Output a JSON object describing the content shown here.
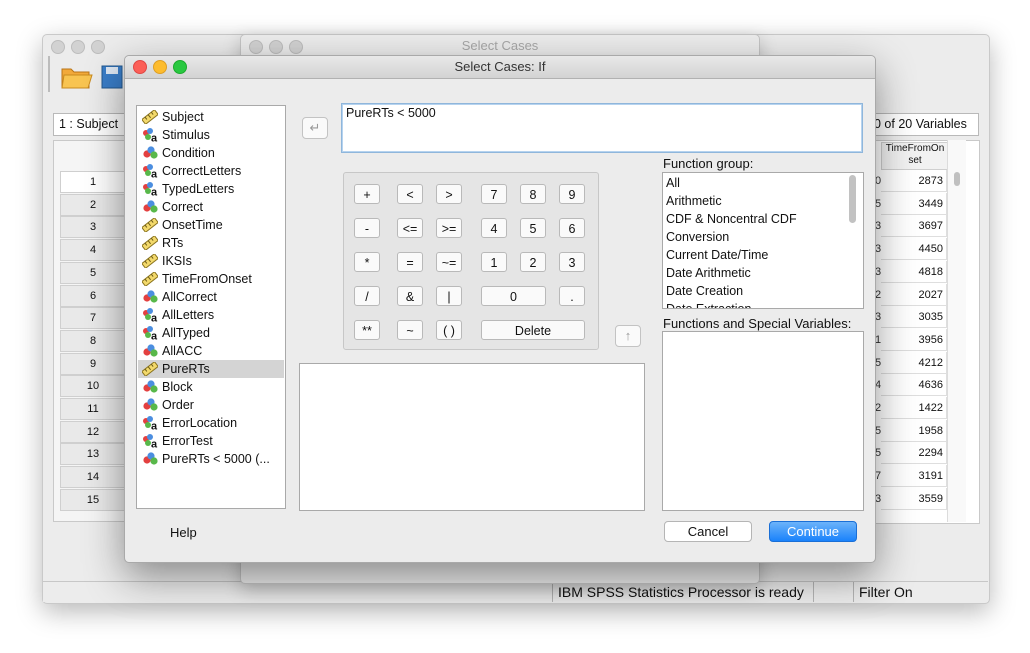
{
  "background_window": {
    "cell_ref": "1 : Subject",
    "var_count": "0 of 20 Variables",
    "row_numbers": [
      "1",
      "2",
      "3",
      "4",
      "5",
      "6",
      "7",
      "8",
      "9",
      "10",
      "11",
      "12",
      "13",
      "14",
      "15"
    ],
    "column_header": "TimeFromOn set",
    "column_values": [
      "2873",
      "3449",
      "3697",
      "4450",
      "4818",
      "2027",
      "3035",
      "3956",
      "4212",
      "4636",
      "1422",
      "1958",
      "2294",
      "3191",
      "3559"
    ],
    "cut_column_values": [
      "0",
      "5",
      "3",
      "3",
      "3",
      "2",
      "3",
      "1",
      "5",
      "4",
      "2",
      "5",
      "5",
      "7",
      "3"
    ],
    "status_processor": "IBM SPSS Statistics Processor is ready",
    "status_filter": "Filter On"
  },
  "middle_window": {
    "title": "Select Cases"
  },
  "dialog": {
    "title": "Select Cases: If",
    "expression": "PureRTs < 5000",
    "variables": [
      {
        "label": "Subject",
        "icon": "ruler-icon"
      },
      {
        "label": "Stimulus",
        "icon": "nominal-string-icon"
      },
      {
        "label": "Condition",
        "icon": "nominal-icon"
      },
      {
        "label": "CorrectLetters",
        "icon": "nominal-string-icon"
      },
      {
        "label": "TypedLetters",
        "icon": "nominal-string-icon"
      },
      {
        "label": "Correct",
        "icon": "nominal-icon"
      },
      {
        "label": "OnsetTime",
        "icon": "ruler-icon"
      },
      {
        "label": "RTs",
        "icon": "ruler-icon"
      },
      {
        "label": "IKSIs",
        "icon": "ruler-icon"
      },
      {
        "label": "TimeFromOnset",
        "icon": "ruler-icon"
      },
      {
        "label": "AllCorrect",
        "icon": "nominal-icon"
      },
      {
        "label": "AllLetters",
        "icon": "nominal-string-icon"
      },
      {
        "label": "AllTyped",
        "icon": "nominal-string-icon"
      },
      {
        "label": "AllACC",
        "icon": "nominal-icon"
      },
      {
        "label": "PureRTs",
        "icon": "ruler-icon",
        "selected": true
      },
      {
        "label": "Block",
        "icon": "nominal-icon"
      },
      {
        "label": "Order",
        "icon": "nominal-icon"
      },
      {
        "label": "ErrorLocation",
        "icon": "nominal-string-icon"
      },
      {
        "label": "ErrorTest",
        "icon": "nominal-string-icon"
      },
      {
        "label": "PureRTs < 5000 (...",
        "icon": "nominal-icon"
      }
    ],
    "keypad": {
      "operators": [
        "+",
        "<",
        ">",
        "-",
        "<=",
        ">=",
        "*",
        "=",
        "~=",
        "/",
        "&",
        "|",
        "**",
        "~",
        "( )"
      ],
      "digits": [
        "7",
        "8",
        "9",
        "4",
        "5",
        "6",
        "1",
        "2",
        "3",
        "0",
        "."
      ],
      "delete_label": "Delete"
    },
    "function_group_label": "Function group:",
    "function_groups": [
      "All",
      "Arithmetic",
      "CDF & Noncentral CDF",
      "Conversion",
      "Current Date/Time",
      "Date Arithmetic",
      "Date Creation",
      "Date Extraction"
    ],
    "functions_label": "Functions and Special Variables:",
    "help_label": "Help",
    "cancel_label": "Cancel",
    "continue_label": "Continue",
    "colors": {
      "continue": "#1a82fb",
      "close": "#fc5f57",
      "minimize": "#fdbc2e",
      "zoom": "#29c840"
    }
  }
}
